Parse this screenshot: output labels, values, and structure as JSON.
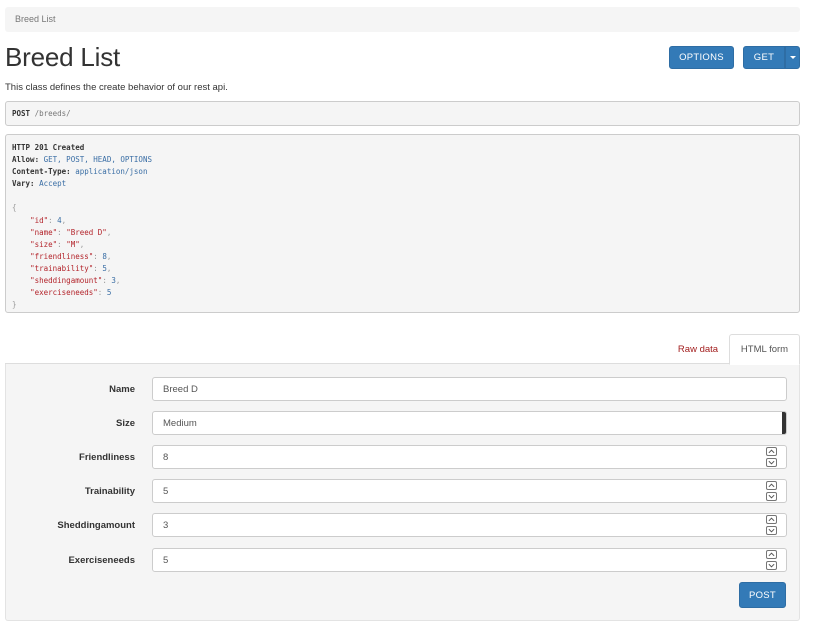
{
  "breadcrumb": {
    "label": "Breed List"
  },
  "page": {
    "title": "Breed List",
    "description": "This class defines the create behavior of our rest api."
  },
  "toolbar": {
    "options_label": "OPTIONS",
    "get_label": "GET"
  },
  "request": {
    "method": "POST",
    "path": "/breeds/"
  },
  "response": {
    "status": "HTTP 201 Created",
    "headers": [
      {
        "key": "Allow:",
        "value": "GET, POST, HEAD, OPTIONS"
      },
      {
        "key": "Content-Type:",
        "value": "application/json"
      },
      {
        "key": "Vary:",
        "value": "Accept"
      }
    ],
    "body": [
      {
        "key": "\"id\"",
        "value": "4",
        "type": "num"
      },
      {
        "key": "\"name\"",
        "value": "\"Breed D\"",
        "type": "str"
      },
      {
        "key": "\"size\"",
        "value": "\"M\"",
        "type": "str"
      },
      {
        "key": "\"friendliness\"",
        "value": "8",
        "type": "num"
      },
      {
        "key": "\"trainability\"",
        "value": "5",
        "type": "num"
      },
      {
        "key": "\"sheddingamount\"",
        "value": "3",
        "type": "num"
      },
      {
        "key": "\"exerciseneeds\"",
        "value": "5",
        "type": "num"
      }
    ]
  },
  "tabs": {
    "raw_label": "Raw data",
    "html_label": "HTML form"
  },
  "form": {
    "fields": [
      {
        "label": "Name",
        "value": "Breed D",
        "kind": "text"
      },
      {
        "label": "Size",
        "value": "Medium",
        "kind": "select"
      },
      {
        "label": "Friendliness",
        "value": "8",
        "kind": "number"
      },
      {
        "label": "Trainability",
        "value": "5",
        "kind": "number"
      },
      {
        "label": "Sheddingamount",
        "value": "3",
        "kind": "number"
      },
      {
        "label": "Exerciseneeds",
        "value": "5",
        "kind": "number"
      }
    ],
    "submit_label": "POST"
  },
  "colors": {
    "primary": "#337ab7",
    "link_red": "#a21d1d",
    "panel_bg": "#f5f5f5"
  }
}
